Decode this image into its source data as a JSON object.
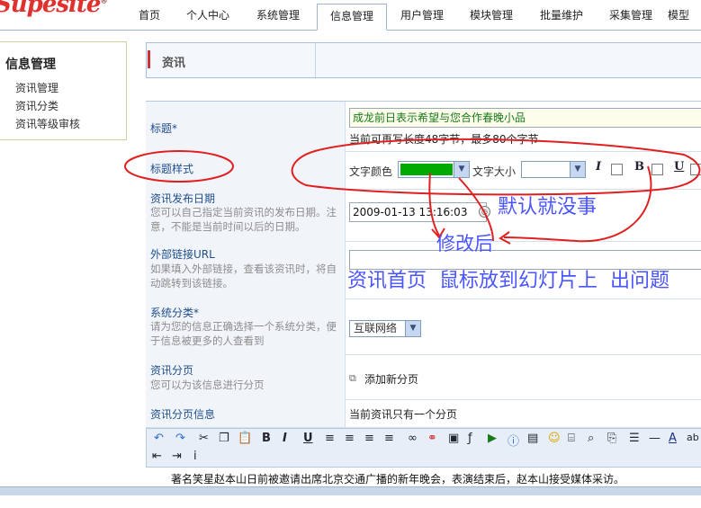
{
  "logo": "Supesite",
  "nav": {
    "tabs": [
      "首页",
      "个人中心",
      "系统管理",
      "信息管理",
      "用户管理",
      "模块管理",
      "批量维护",
      "采集管理",
      "模型"
    ],
    "active": "信息管理"
  },
  "sidebar": {
    "title": "信息管理",
    "items": [
      "资讯管理",
      "资讯分类",
      "资讯等级审核"
    ]
  },
  "content": {
    "section_title": "资讯"
  },
  "form": {
    "title": {
      "label": "标题*",
      "value": "成龙前日表示希望与您合作春晚小品",
      "hint": "当前可再写长度48字节，最多80个字节"
    },
    "style": {
      "label": "标题样式",
      "color_label": "文字颜色",
      "size_label": "文字大小",
      "color_value": "#00aa00",
      "italic": "I",
      "bold": "B",
      "underline": "U"
    },
    "date": {
      "label": "资讯发布日期",
      "desc": "您可以自己指定当前资讯的发布日期。注意，不能是当前时间以后的日期。",
      "value": "2009-01-13 13:16:03"
    },
    "url": {
      "label": "外部链接URL",
      "desc": "如果填入外部链接，查看该资讯时，将自动跳转到该链接。"
    },
    "category": {
      "label": "系统分类*",
      "desc": "请为您的信息正确选择一个系统分类，便于信息被更多的人查看到",
      "value": "互联网络"
    },
    "paging": {
      "label": "资讯分页",
      "desc": "您可以为该信息进行分页",
      "add_label": "添加新分页"
    },
    "paging_info": {
      "label": "资讯分页信息",
      "value": "当前资讯只有一个分页"
    }
  },
  "editor": {
    "text": "著名笑星赵本山日前被邀请出席北京交通广播的新年晚会，表演结束后，赵本山接受媒体采访。"
  },
  "annotations": {
    "default_ok": "默认就没事",
    "after_change": "修改后",
    "problem": "资讯首页  鼠标放到幻灯片上  出问题"
  }
}
